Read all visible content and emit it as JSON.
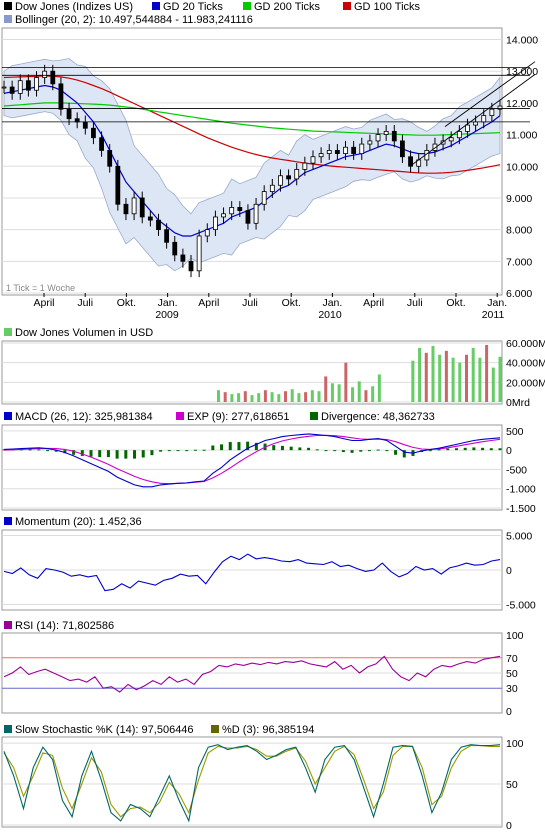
{
  "chart_data": [
    {
      "type": "line",
      "panel": "price",
      "legend": [
        {
          "label": "Dow Jones (Indizes US)",
          "color": "#000000"
        },
        {
          "label": "GD 20 Ticks",
          "color": "#0000cc"
        },
        {
          "label": "GD 200 Ticks",
          "color": "#00cc00"
        },
        {
          "label": "GD 100 Ticks",
          "color": "#cc0000"
        },
        {
          "label": "Bollinger (20, 2): 10.497,544884 - 11.983,241116",
          "color": "#8899cc"
        }
      ],
      "y_ticks": [
        "14.000",
        "13.000",
        "12.000",
        "11.000",
        "10.000",
        "9.000",
        "8.000",
        "7.000",
        "6.000"
      ],
      "ylim": [
        6000,
        14300
      ],
      "x_ticks": [
        "April",
        "Juli",
        "Okt.",
        "Jan.",
        "April",
        "Juli",
        "Okt.",
        "Jan.",
        "April",
        "Juli",
        "Okt.",
        "Jan."
      ],
      "x_year_labels": [
        "2009",
        "2010",
        "2011"
      ],
      "note": "1 Tick = 1 Woche",
      "series": [
        {
          "name": "Dow Jones (Indizes US)",
          "values": [
            12500,
            12300,
            12700,
            12400,
            12800,
            13000,
            12600,
            11800,
            11500,
            11400,
            11200,
            10900,
            10500,
            10000,
            8800,
            8500,
            9000,
            8400,
            8300,
            8000,
            7600,
            7200,
            7000,
            6700,
            7800,
            8000,
            8400,
            8500,
            8700,
            8600,
            8200,
            8800,
            9200,
            9400,
            9700,
            9600,
            9900,
            10100,
            10300,
            10400,
            10500,
            10400,
            10600,
            10400,
            10700,
            10800,
            11000,
            11100,
            10800,
            10300,
            10000,
            10200,
            10500,
            10700,
            10800,
            10900,
            11100,
            11300,
            11400,
            11600,
            11800,
            11900
          ]
        },
        {
          "name": "GD 20 Ticks",
          "values": [
            12300,
            12350,
            12400,
            12450,
            12500,
            12550,
            12500,
            12400,
            12200,
            12000,
            11700,
            11400,
            11000,
            10500,
            10000,
            9500,
            9200,
            8900,
            8600,
            8300,
            8100,
            7900,
            7800,
            7800,
            7900,
            8000,
            8100,
            8200,
            8400,
            8500,
            8600,
            8700,
            8900,
            9100,
            9300,
            9400,
            9600,
            9800,
            9900,
            10000,
            10100,
            10200,
            10300,
            10350,
            10400,
            10500,
            10600,
            10700,
            10650,
            10550,
            10450,
            10400,
            10400,
            10450,
            10550,
            10650,
            10800,
            10950,
            11100,
            11250,
            11400,
            11600
          ]
        },
        {
          "name": "GD 200 Ticks",
          "values": [
            11900,
            11920,
            11940,
            11960,
            11980,
            12000,
            12000,
            12000,
            11990,
            11980,
            11970,
            11960,
            11950,
            11930,
            11900,
            11870,
            11840,
            11800,
            11760,
            11720,
            11680,
            11640,
            11600,
            11560,
            11520,
            11480,
            11440,
            11400,
            11360,
            11330,
            11300,
            11270,
            11240,
            11210,
            11190,
            11170,
            11150,
            11130,
            11110,
            11100,
            11090,
            11080,
            11070,
            11060,
            11050,
            11040,
            11030,
            11020,
            11010,
            11000,
            10990,
            10980,
            10980,
            10980,
            10990,
            11000,
            11010,
            11020,
            11030,
            11040,
            11050,
            11060
          ]
        },
        {
          "name": "GD 100 Ticks",
          "values": [
            12800,
            12810,
            12820,
            12830,
            12840,
            12850,
            12840,
            12820,
            12780,
            12720,
            12640,
            12550,
            12450,
            12340,
            12220,
            12100,
            11980,
            11860,
            11740,
            11620,
            11500,
            11380,
            11260,
            11140,
            11020,
            10900,
            10800,
            10700,
            10600,
            10520,
            10440,
            10370,
            10310,
            10260,
            10220,
            10180,
            10140,
            10100,
            10070,
            10040,
            10010,
            9990,
            9970,
            9950,
            9930,
            9910,
            9890,
            9870,
            9850,
            9830,
            9810,
            9790,
            9780,
            9780,
            9790,
            9810,
            9840,
            9870,
            9910,
            9950,
            10000,
            10050
          ]
        }
      ]
    },
    {
      "type": "bar",
      "panel": "volume",
      "legend": [
        {
          "label": "Dow Jones Volumen in USD",
          "color": "#66cc66"
        }
      ],
      "y_ticks": [
        "60.000M",
        "40.000M",
        "20.000M",
        "0Mrd"
      ],
      "ylim": [
        0,
        60000
      ],
      "values": [
        0,
        0,
        0,
        0,
        0,
        0,
        0,
        0,
        0,
        0,
        0,
        0,
        0,
        0,
        0,
        0,
        0,
        0,
        0,
        0,
        0,
        0,
        0,
        0,
        0,
        0,
        0,
        0,
        0,
        0,
        0,
        0,
        12000,
        10000,
        8000,
        9000,
        11000,
        7000,
        9000,
        12000,
        10000,
        8000,
        11000,
        13000,
        9000,
        10000,
        12000,
        11000,
        26000,
        19000,
        18000,
        40000,
        15000,
        21000,
        12000,
        16000,
        28000,
        0,
        0,
        0,
        0,
        42000,
        55000,
        50000,
        57000,
        48000,
        52000,
        45000,
        40000,
        48000,
        55000,
        45000,
        58000,
        35000,
        46000
      ]
    },
    {
      "type": "line",
      "panel": "macd",
      "legend": [
        {
          "label": "MACD (26, 12): 325,981384",
          "color": "#0000cc"
        },
        {
          "label": "EXP (9): 277,618651",
          "color": "#cc00cc"
        },
        {
          "label": "Divergence: 48,362733",
          "color": "#006600"
        }
      ],
      "y_ticks": [
        "500",
        "0",
        "-500",
        "-1.000",
        "-1.500"
      ],
      "ylim": [
        -1500,
        600
      ],
      "series": [
        {
          "name": "MACD (26, 12): 325,981384",
          "values": [
            20,
            30,
            40,
            50,
            60,
            40,
            0,
            -60,
            -150,
            -250,
            -350,
            -450,
            -550,
            -700,
            -800,
            -900,
            -950,
            -950,
            -900,
            -880,
            -860,
            -850,
            -820,
            -800,
            -600,
            -450,
            -250,
            -100,
            50,
            150,
            250,
            300,
            350,
            380,
            400,
            420,
            400,
            380,
            350,
            300,
            250,
            250,
            280,
            300,
            250,
            100,
            -50,
            -80,
            -20,
            20,
            50,
            100,
            150,
            200,
            250,
            280,
            300,
            320
          ]
        },
        {
          "name": "EXP (9): 277,618651",
          "values": [
            0,
            10,
            20,
            30,
            40,
            45,
            40,
            20,
            -30,
            -100,
            -180,
            -270,
            -370,
            -480,
            -580,
            -680,
            -760,
            -820,
            -860,
            -870,
            -860,
            -850,
            -830,
            -810,
            -720,
            -600,
            -460,
            -310,
            -170,
            -40,
            80,
            170,
            240,
            290,
            330,
            360,
            380,
            385,
            375,
            350,
            320,
            290,
            280,
            285,
            275,
            220,
            140,
            70,
            30,
            20,
            30,
            60,
            100,
            140,
            180,
            220,
            250,
            280
          ]
        },
        {
          "name": "Divergence: 48,362733",
          "values": [
            20,
            20,
            20,
            20,
            20,
            -5,
            -40,
            -80,
            -120,
            -150,
            -170,
            -180,
            -180,
            -220,
            -220,
            -220,
            -190,
            -130,
            -40,
            -10,
            0,
            0,
            10,
            10,
            120,
            150,
            210,
            210,
            220,
            190,
            170,
            130,
            110,
            90,
            70,
            60,
            20,
            -5,
            -25,
            -50,
            -70,
            -40,
            0,
            15,
            -25,
            -120,
            -190,
            -150,
            -50,
            0,
            20,
            40,
            50,
            60,
            70,
            60,
            50,
            48
          ]
        }
      ]
    },
    {
      "type": "line",
      "panel": "momentum",
      "legend": [
        {
          "label": "Momentum (20): 1.452,36",
          "color": "#0000cc"
        }
      ],
      "y_ticks": [
        "5.000",
        "0",
        "-5.000"
      ],
      "ylim": [
        -5500,
        5500
      ],
      "series": [
        {
          "name": "Momentum (20): 1.452,36",
          "values": [
            -200,
            -500,
            300,
            -700,
            -1200,
            200,
            0,
            -300,
            -900,
            -700,
            -1000,
            -800,
            -3000,
            -2800,
            -2000,
            -2600,
            -1600,
            -1900,
            -2200,
            -1500,
            -1200,
            -600,
            -900,
            -800,
            -2000,
            -300,
            1200,
            2000,
            1500,
            2300,
            1600,
            1800,
            1600,
            1300,
            1200,
            1500,
            1000,
            900,
            800,
            1200,
            500,
            700,
            200,
            -200,
            0,
            1000,
            -200,
            -1000,
            -500,
            500,
            0,
            200,
            -600,
            300,
            600,
            1000,
            700,
            800,
            1300,
            1500
          ]
        }
      ]
    },
    {
      "type": "line",
      "panel": "rsi",
      "legend": [
        {
          "label": "RSI (14): 71,802586",
          "color": "#990099"
        }
      ],
      "y_ticks": [
        "100",
        "70",
        "50",
        "30",
        "0"
      ],
      "y_tick_colors": [
        "#000000",
        "#ff0000",
        "#000000",
        "#3333cc",
        "#000000"
      ],
      "ylim": [
        0,
        100
      ],
      "series": [
        {
          "name": "RSI (14): 71,802586",
          "values": [
            45,
            50,
            58,
            48,
            52,
            55,
            50,
            45,
            40,
            42,
            38,
            45,
            30,
            32,
            25,
            35,
            28,
            33,
            40,
            35,
            45,
            38,
            42,
            35,
            48,
            52,
            60,
            58,
            62,
            60,
            63,
            61,
            64,
            62,
            65,
            64,
            66,
            62,
            60,
            58,
            65,
            55,
            60,
            50,
            58,
            62,
            72,
            55,
            45,
            40,
            50,
            45,
            55,
            60,
            58,
            62,
            65,
            63,
            68,
            70,
            72
          ]
        }
      ]
    },
    {
      "type": "line",
      "panel": "stochastic",
      "legend": [
        {
          "label": "Slow Stochastic %K (14): 97,506446",
          "color": "#006666"
        },
        {
          "label": "%D (3): 96,385194",
          "color": "#666600"
        }
      ],
      "y_ticks": [
        "100",
        "50",
        "0"
      ],
      "ylim": [
        0,
        105
      ],
      "series": [
        {
          "name": "Slow Stochastic %K (14): 97,506446",
          "values": [
            90,
            60,
            20,
            70,
            95,
            80,
            30,
            10,
            60,
            90,
            55,
            15,
            5,
            25,
            20,
            10,
            35,
            60,
            30,
            5,
            70,
            95,
            98,
            92,
            95,
            97,
            90,
            80,
            85,
            92,
            95,
            70,
            40,
            80,
            95,
            97,
            80,
            45,
            10,
            50,
            95,
            97,
            96,
            60,
            15,
            40,
            80,
            95,
            98,
            97,
            97,
            98
          ]
        },
        {
          "name": "%D (3): 96,385194",
          "values": [
            88,
            70,
            35,
            60,
            88,
            85,
            45,
            20,
            50,
            82,
            65,
            25,
            10,
            20,
            22,
            15,
            28,
            52,
            38,
            15,
            55,
            88,
            96,
            94,
            94,
            96,
            92,
            84,
            84,
            90,
            94,
            78,
            50,
            70,
            90,
            96,
            86,
            55,
            20,
            40,
            85,
            96,
            96,
            70,
            25,
            35,
            70,
            90,
            97,
            97,
            96,
            96
          ]
        }
      ]
    }
  ]
}
